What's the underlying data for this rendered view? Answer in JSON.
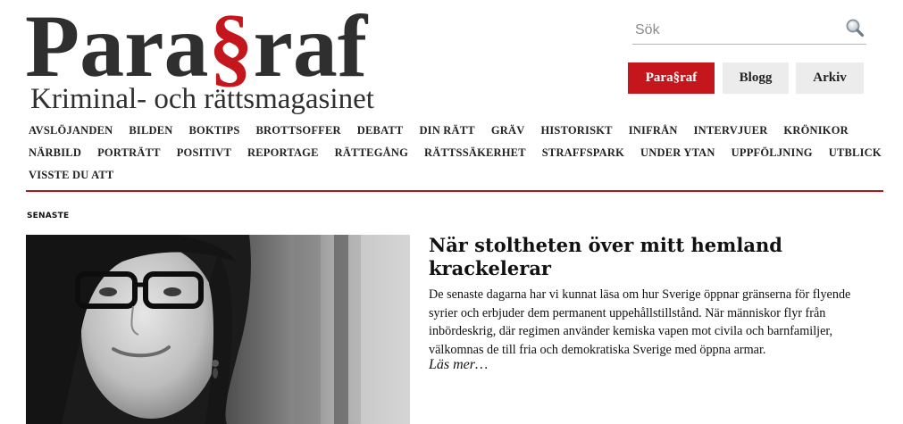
{
  "header": {
    "logo_pre": "Para",
    "logo_mark": "§",
    "logo_post": "raf",
    "tagline": "Kriminal- och rättsmagasinet"
  },
  "search": {
    "placeholder": "Sök",
    "icon": "search-icon"
  },
  "top_buttons": {
    "paragraf": "Para§raf",
    "blogg": "Blogg",
    "arkiv": "Arkiv"
  },
  "nav": {
    "row1": [
      "AVSLÖJANDEN",
      "BILDEN",
      "BOKTIPS",
      "BROTTSOFFER",
      "DEBATT",
      "DIN RÄTT",
      "GRÄV",
      "HISTORISKT",
      "INIFRÅN",
      "INTERVJUER",
      "KRÖNIKOR"
    ],
    "row2": [
      "NÄRBILD",
      "PORTRÄTT",
      "POSITIVT",
      "REPORTAGE",
      "RÄTTEGÅNG",
      "RÄTTSSÄKERHET",
      "STRAFFSPARK",
      "UNDER YTAN",
      "UPPFÖLJNING",
      "UTBLICK"
    ],
    "row3": [
      "VISSTE DU ATT"
    ]
  },
  "colors": {
    "accent": "#c4161c",
    "logo_text": "#2f2f2f",
    "button_bg": "#ececec"
  },
  "latest": {
    "section_label": "SENASTE",
    "headline": "När stoltheten över mitt hemland krackelerar",
    "excerpt": "De senaste dagarna har vi kunnat läsa om hur Sverige öppnar gränserna för flyende syrier och erbjuder dem permanent uppehållstillstånd. När människor flyr från inbördeskrig, där regimen använder kemiska vapen mot civila och barnfamiljer, välkomnas de till fria och demokratiska Sverige med öppna armar.",
    "read_more": "Läs mer…"
  }
}
